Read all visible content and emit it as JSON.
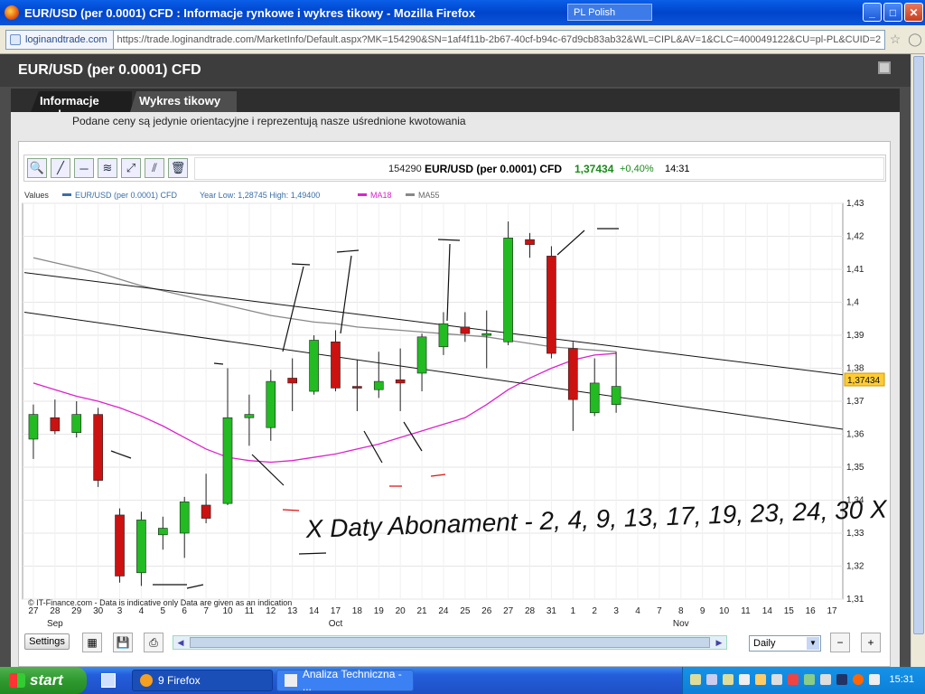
{
  "window": {
    "title": "EUR/USD (per 0.0001) CFD : Informacje rynkowe i wykres tikowy - Mozilla Firefox",
    "language": "PL Polish"
  },
  "address": {
    "site": "loginandtrade.com",
    "url": "https://trade.loginandtrade.com/MarketInfo/Default.aspx?MK=154290&SN=1af4f11b-2b67-40cf-b94c-67d9cb83ab32&WL=CIPL&AV=1&CLC=400049122&CU=pl-PL&CUID=2"
  },
  "page": {
    "heading": "EUR/USD (per 0.0001) CFD",
    "tabs": [
      {
        "label": "Informacje rynkowe"
      },
      {
        "label": "Wykres tikowy"
      }
    ],
    "notice": "Podane ceny są jedynie orientacyjne i reprezentują nasze uśrednione kwotowania"
  },
  "quote": {
    "code": "154290",
    "name": "EUR/USD (per 0.0001) CFD",
    "price": "1,37434",
    "change": "+0,40%",
    "time": "14:31"
  },
  "legend": {
    "values": "Values",
    "series": "EUR/USD (per 0.0001) CFD",
    "range": "Year Low: 1,28745  High: 1,49400",
    "ma18": "MA18",
    "ma55": "MA55"
  },
  "colors": {
    "up": "#22bb22",
    "down": "#cc1111",
    "ma18": "#dd22cc",
    "ma55": "#888888",
    "badge": "#ffcc33"
  },
  "chart_data": {
    "type": "candlestick",
    "title": "EUR/USD (per 0.0001) CFD",
    "ylim": [
      1.31,
      1.43
    ],
    "yticks": [
      "1,31",
      "1,32",
      "1,33",
      "1,34",
      "1,35",
      "1,36",
      "1,37",
      "1,38",
      "1,39",
      "1,4",
      "1,41",
      "1,42",
      "1,43"
    ],
    "x_ticks": [
      "27",
      "28",
      "29",
      "30",
      "3",
      "4",
      "5",
      "6",
      "7",
      "10",
      "11",
      "12",
      "13",
      "14",
      "17",
      "18",
      "19",
      "20",
      "21",
      "24",
      "25",
      "26",
      "27",
      "28",
      "31",
      "1",
      "2",
      "3",
      "4",
      "7",
      "8",
      "9",
      "10",
      "11",
      "14",
      "15",
      "16",
      "17"
    ],
    "months": [
      {
        "label": "Sep",
        "at": "28"
      },
      {
        "label": "Oct",
        "at": "17"
      },
      {
        "label": "Nov",
        "at": "8"
      }
    ],
    "last_price": "1,37434",
    "candles": [
      {
        "d": "27",
        "o": 1.3585,
        "c": 1.366,
        "h": 1.369,
        "l": 1.3525
      },
      {
        "d": "28",
        "o": 1.365,
        "c": 1.361,
        "h": 1.3705,
        "l": 1.36
      },
      {
        "d": "29",
        "o": 1.3605,
        "c": 1.366,
        "h": 1.37,
        "l": 1.359
      },
      {
        "d": "30",
        "o": 1.366,
        "c": 1.346,
        "h": 1.368,
        "l": 1.344
      },
      {
        "d": "3",
        "o": 1.3355,
        "c": 1.317,
        "h": 1.3375,
        "l": 1.315
      },
      {
        "d": "4",
        "o": 1.318,
        "c": 1.334,
        "h": 1.3365,
        "l": 1.314
      },
      {
        "d": "5",
        "o": 1.3295,
        "c": 1.3315,
        "h": 1.335,
        "l": 1.325
      },
      {
        "d": "6",
        "o": 1.33,
        "c": 1.3395,
        "h": 1.341,
        "l": 1.3225
      },
      {
        "d": "7",
        "o": 1.3385,
        "c": 1.3345,
        "h": 1.348,
        "l": 1.333
      },
      {
        "d": "10",
        "o": 1.339,
        "c": 1.365,
        "h": 1.38,
        "l": 1.3385
      },
      {
        "d": "11",
        "o": 1.365,
        "c": 1.366,
        "h": 1.372,
        "l": 1.3565
      },
      {
        "d": "12",
        "o": 1.362,
        "c": 1.376,
        "h": 1.3795,
        "l": 1.358
      },
      {
        "d": "13",
        "o": 1.377,
        "c": 1.3755,
        "h": 1.383,
        "l": 1.367
      },
      {
        "d": "14",
        "o": 1.373,
        "c": 1.3885,
        "h": 1.39,
        "l": 1.372
      },
      {
        "d": "17",
        "o": 1.388,
        "c": 1.374,
        "h": 1.3915,
        "l": 1.373
      },
      {
        "d": "18",
        "o": 1.3745,
        "c": 1.374,
        "h": 1.3825,
        "l": 1.367
      },
      {
        "d": "19",
        "o": 1.3735,
        "c": 1.376,
        "h": 1.385,
        "l": 1.371
      },
      {
        "d": "20",
        "o": 1.3765,
        "c": 1.3755,
        "h": 1.386,
        "l": 1.367
      },
      {
        "d": "21",
        "o": 1.3785,
        "c": 1.3895,
        "h": 1.3905,
        "l": 1.373
      },
      {
        "d": "24",
        "o": 1.3865,
        "c": 1.3935,
        "h": 1.397,
        "l": 1.384
      },
      {
        "d": "25",
        "o": 1.3925,
        "c": 1.3905,
        "h": 1.397,
        "l": 1.388
      },
      {
        "d": "26",
        "o": 1.3905,
        "c": 1.3905,
        "h": 1.3975,
        "l": 1.38
      },
      {
        "d": "27",
        "o": 1.388,
        "c": 1.4195,
        "h": 1.4245,
        "l": 1.387
      },
      {
        "d": "28",
        "o": 1.419,
        "c": 1.4175,
        "h": 1.421,
        "l": 1.4135
      },
      {
        "d": "31",
        "o": 1.414,
        "c": 1.3845,
        "h": 1.417,
        "l": 1.383
      },
      {
        "d": "1",
        "o": 1.386,
        "c": 1.3705,
        "h": 1.388,
        "l": 1.361
      },
      {
        "d": "2",
        "o": 1.3665,
        "c": 1.3755,
        "h": 1.383,
        "l": 1.3655
      },
      {
        "d": "3",
        "o": 1.369,
        "c": 1.3745,
        "h": 1.385,
        "l": 1.3665
      }
    ],
    "ma18": [
      1.3755,
      1.3735,
      1.3715,
      1.37,
      1.368,
      1.3655,
      1.3625,
      1.359,
      1.3555,
      1.353,
      1.352,
      1.3515,
      1.352,
      1.353,
      1.354,
      1.3555,
      1.357,
      1.359,
      1.361,
      1.363,
      1.365,
      1.369,
      1.3735,
      1.377,
      1.38,
      1.3825,
      1.384,
      1.3845
    ],
    "ma55": [
      1.4135,
      1.412,
      1.4105,
      1.409,
      1.407,
      1.405,
      1.4035,
      1.402,
      1.4005,
      1.399,
      1.3975,
      1.396,
      1.395,
      1.394,
      1.3935,
      1.3925,
      1.392,
      1.3915,
      1.391,
      1.3905,
      1.39,
      1.3895,
      1.3885,
      1.3875,
      1.3865,
      1.386,
      1.3855,
      1.385
    ],
    "trendlines": [
      {
        "from": [
          "27",
          1.409
        ],
        "to": [
          "17",
          1.378
        ]
      },
      {
        "from": [
          "27",
          1.397
        ],
        "to": [
          "17",
          1.3615
        ]
      }
    ],
    "annotation": "X Daty Abonament - 2, 4, 9, 13, 17, 19, 23, 24, 30 X",
    "footer": "© IT-Finance.com - Data is indicative only Data are given as an indication"
  },
  "chart_controls": {
    "settings": "Settings",
    "period": "Daily"
  },
  "taskbar": {
    "start": "start",
    "task1": "9 Firefox",
    "task2": "Analiza Techniczna - ...",
    "clock": "15:31"
  }
}
